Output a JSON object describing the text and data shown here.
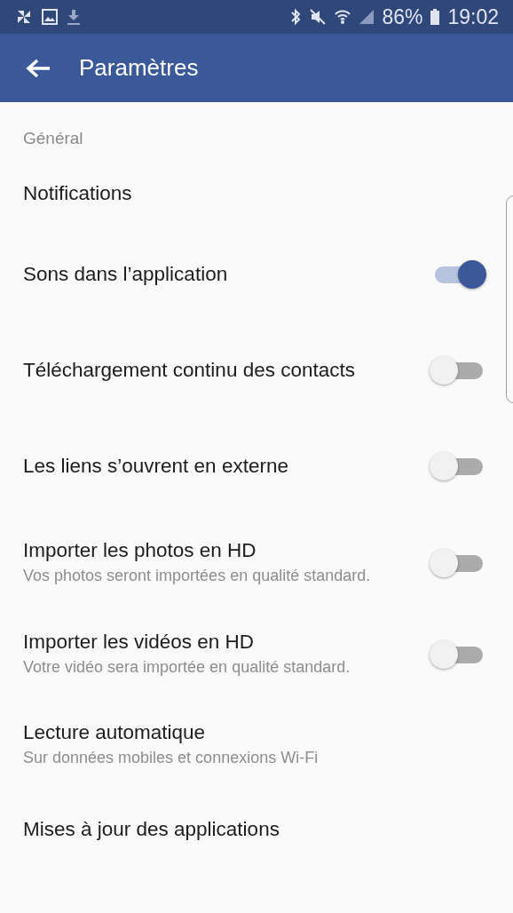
{
  "status_bar": {
    "battery": "86%",
    "time": "19:02"
  },
  "app_bar": {
    "title": "Paramètres"
  },
  "section": "Général",
  "items": [
    {
      "kind": "link",
      "title": "Notifications"
    },
    {
      "kind": "toggle",
      "title": "Sons dans l’application",
      "on": true
    },
    {
      "kind": "toggle",
      "title": "Téléchargement continu des contacts",
      "on": false
    },
    {
      "kind": "toggle",
      "title": "Les liens s’ouvrent en externe",
      "on": false
    },
    {
      "kind": "toggle",
      "title": "Importer les photos en HD",
      "subtitle": "Vos photos seront importées en qualité standard.",
      "on": false
    },
    {
      "kind": "toggle",
      "title": "Importer les vidéos en HD",
      "subtitle": "Votre vidéo sera importée en qualité standard.",
      "on": false
    },
    {
      "kind": "link",
      "title": "Lecture automatique",
      "subtitle": "Sur données mobiles et connexions Wi-Fi"
    },
    {
      "kind": "link",
      "title": "Mises à jour des applications"
    }
  ]
}
